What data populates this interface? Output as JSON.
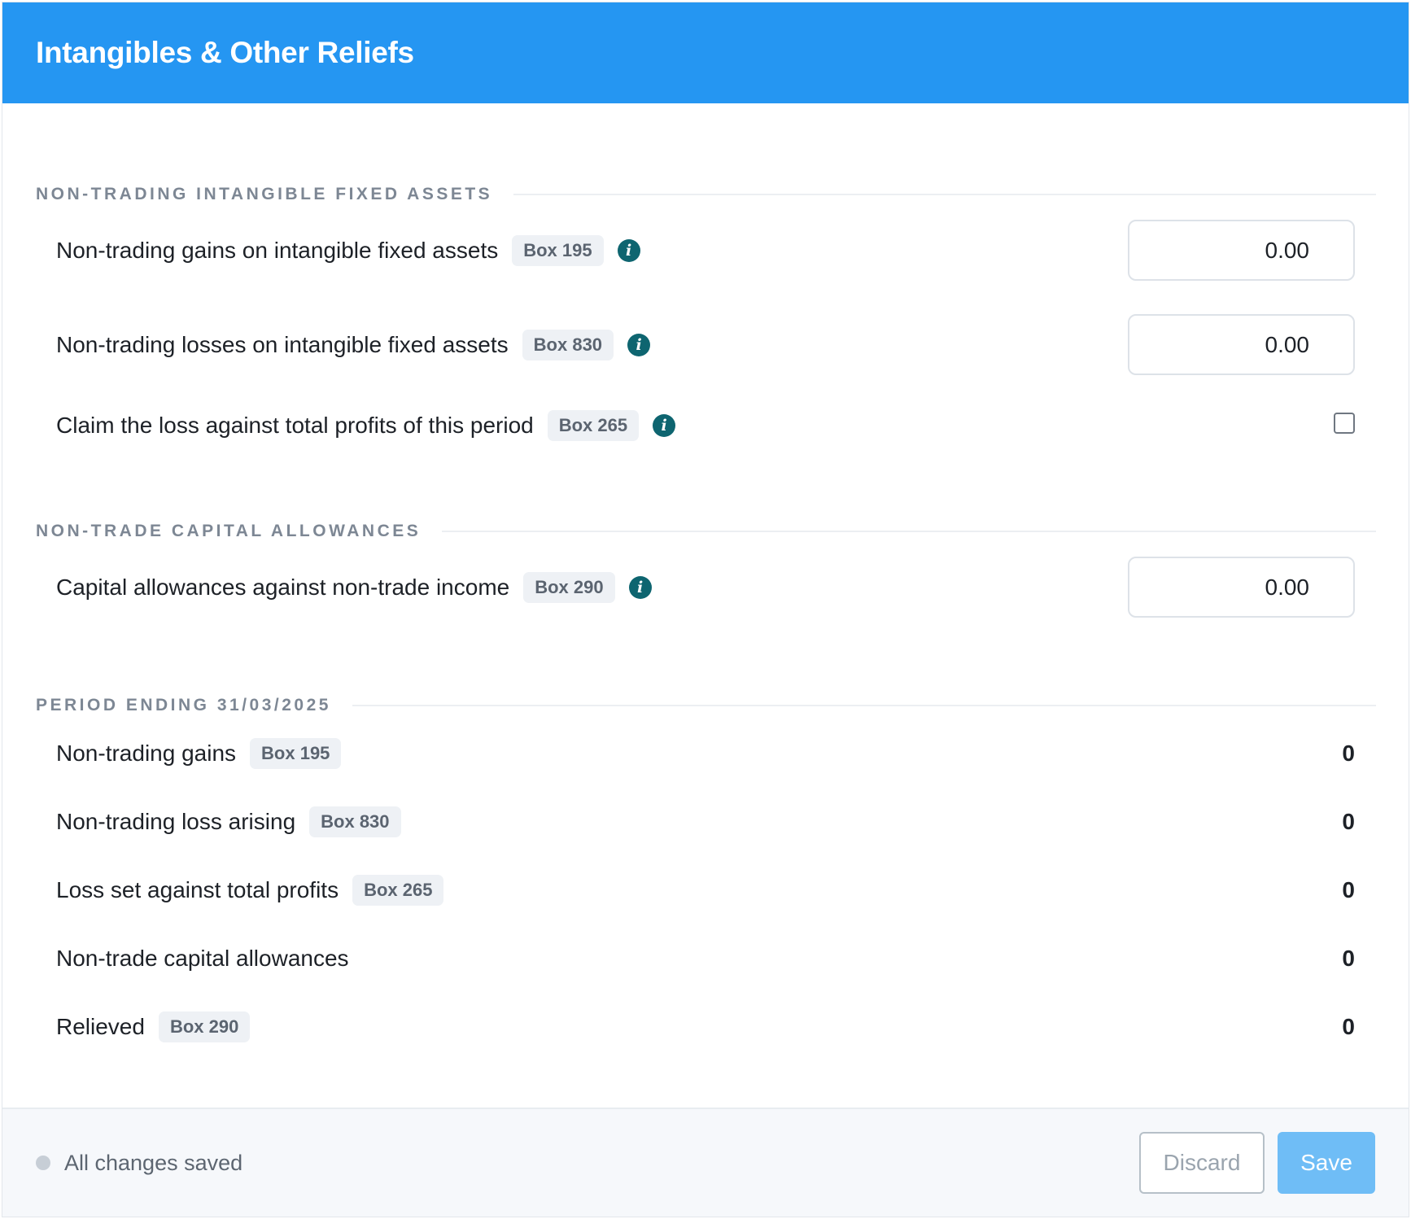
{
  "header": {
    "title": "Intangibles & Other Reliefs"
  },
  "sections": {
    "intangibles": {
      "title": "NON-TRADING INTANGIBLE FIXED ASSETS",
      "rows": [
        {
          "label": "Non-trading gains on intangible fixed assets",
          "box": "Box 195",
          "value": "0.00"
        },
        {
          "label": "Non-trading losses on intangible fixed assets",
          "box": "Box 830",
          "value": "0.00"
        },
        {
          "label": "Claim the loss against total profits of this period",
          "box": "Box 265",
          "checked": false
        }
      ]
    },
    "capital": {
      "title": "NON-TRADE CAPITAL ALLOWANCES",
      "rows": [
        {
          "label": "Capital allowances against non-trade income",
          "box": "Box 290",
          "value": "0.00"
        }
      ]
    },
    "period": {
      "title": "PERIOD ENDING 31/03/2025",
      "rows": [
        {
          "label": "Non-trading gains",
          "box": "Box 195",
          "value": "0"
        },
        {
          "label": "Non-trading loss arising",
          "box": "Box 830",
          "value": "0"
        },
        {
          "label": "Loss set against total profits",
          "box": "Box 265",
          "value": "0"
        },
        {
          "label": "Non-trade capital allowances",
          "value": "0"
        },
        {
          "label": "Relieved",
          "box": "Box 290",
          "value": "0"
        }
      ]
    }
  },
  "info_icon": "info-icon",
  "footer": {
    "status": "All changes saved",
    "discard_label": "Discard",
    "save_label": "Save"
  },
  "colors": {
    "header_bg": "#2596f2",
    "info_icon": "#0e6570",
    "save_button": "#6fbdf6"
  }
}
